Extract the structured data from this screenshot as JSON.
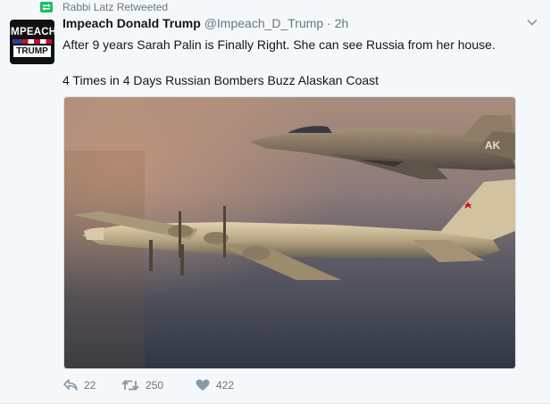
{
  "retweet_context": {
    "text": "Rabbi Latz Retweeted",
    "icon": "retweet-icon"
  },
  "author": {
    "name": "Impeach Donald Trump",
    "handle": "@Impeach_D_Trump",
    "separator": "·",
    "time": "2h",
    "avatar": {
      "line1": "IMPEACH",
      "line2": "TRUMP"
    }
  },
  "tweet": {
    "text_line1": "After 9 years Sarah Palin is Finally Right.  She can see Russia from her house.",
    "text_line2": "4 Times in 4 Days Russian Bombers Buzz Alaskan Coast"
  },
  "media": {
    "fighter_tail_marking": "AK"
  },
  "actions": {
    "reply": {
      "icon": "reply-icon",
      "count": "22"
    },
    "retweet": {
      "icon": "retweet-icon",
      "count": "250"
    },
    "like": {
      "icon": "heart-icon",
      "count": "422"
    }
  },
  "colors": {
    "accent_green": "#17bf63",
    "secondary_text": "#657786"
  }
}
